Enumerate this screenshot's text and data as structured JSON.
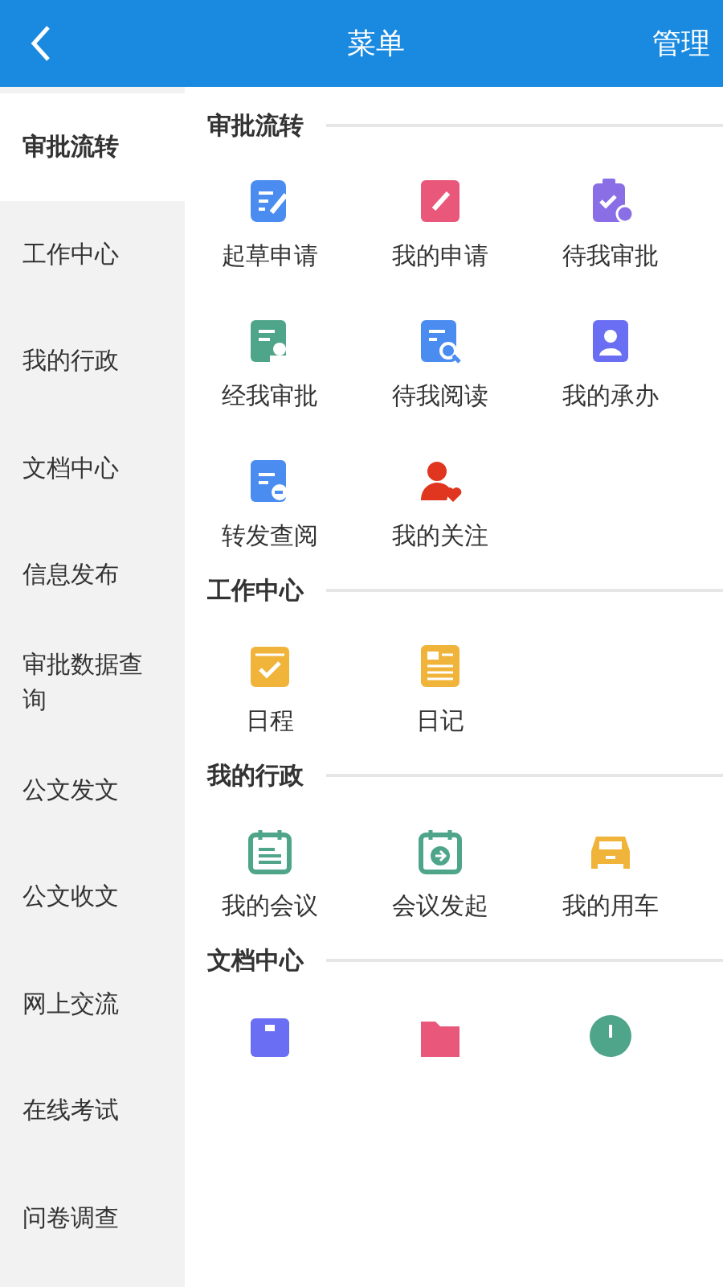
{
  "header": {
    "title": "菜单",
    "action": "管理"
  },
  "sidebar": {
    "items": [
      {
        "label": "审批流转",
        "selected": true
      },
      {
        "label": "工作中心",
        "selected": false
      },
      {
        "label": "我的行政",
        "selected": false
      },
      {
        "label": "文档中心",
        "selected": false
      },
      {
        "label": "信息发布",
        "selected": false
      },
      {
        "label": "审批数据查询",
        "selected": false
      },
      {
        "label": "公文发文",
        "selected": false
      },
      {
        "label": "公文收文",
        "selected": false
      },
      {
        "label": "网上交流",
        "selected": false
      },
      {
        "label": "在线考试",
        "selected": false
      },
      {
        "label": "问卷调查",
        "selected": false
      }
    ]
  },
  "sections": [
    {
      "title": "审批流转",
      "items": [
        {
          "label": "起草申请",
          "kind": "draft",
          "color": "#4a8cf0"
        },
        {
          "label": "我的申请",
          "kind": "notebook",
          "color": "#e9587a"
        },
        {
          "label": "待我审批",
          "kind": "clipboard",
          "color": "#8a6ee6"
        },
        {
          "label": "经我审批",
          "kind": "stamp",
          "color": "#4fa58a"
        },
        {
          "label": "待我阅读",
          "kind": "search-doc",
          "color": "#4a8cf0"
        },
        {
          "label": "我的承办",
          "kind": "person-doc",
          "color": "#6a6ef2"
        },
        {
          "label": "转发查阅",
          "kind": "forward-doc",
          "color": "#4a8cf0"
        },
        {
          "label": "我的关注",
          "kind": "person-heart",
          "color": "#e0351e"
        }
      ]
    },
    {
      "title": "工作中心",
      "items": [
        {
          "label": "日程",
          "kind": "check-cal",
          "color": "#f0b43a"
        },
        {
          "label": "日记",
          "kind": "news",
          "color": "#f0b43a"
        }
      ]
    },
    {
      "title": "我的行政",
      "items": [
        {
          "label": "我的会议",
          "kind": "calendar",
          "color": "#4fa58a"
        },
        {
          "label": "会议发起",
          "kind": "calendar-arrow",
          "color": "#4fa58a"
        },
        {
          "label": "我的用车",
          "kind": "car",
          "color": "#f0b43a"
        }
      ]
    },
    {
      "title": "文档中心",
      "items": [
        {
          "kind": "box",
          "color": "#6a6ef2"
        },
        {
          "kind": "folder",
          "color": "#e9587a"
        },
        {
          "kind": "circle",
          "color": "#4fa58a"
        }
      ]
    }
  ]
}
